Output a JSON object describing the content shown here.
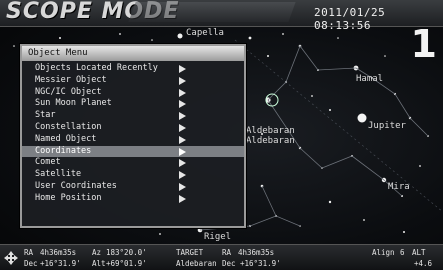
{
  "header": {
    "mode_title": "SCOPE MODE",
    "datetime": "2011/01/25 08:13:56",
    "screen_number": "1"
  },
  "sky_labels": {
    "capella": "Capella",
    "aldebaran_1": "Aldebaran",
    "aldebaran_2": "Aldebaran",
    "jupiter": "Jupiter",
    "mira": "Mira",
    "rigel": "Rigel",
    "hamal": "Hamal"
  },
  "menu": {
    "title": "Object Menu",
    "selected_index": 8,
    "items": [
      "Objects Located Recently",
      "Messier Object",
      "NGC/IC Object",
      "Sun Moon Planet",
      "Star",
      "Constellation",
      "Named Object",
      "Coordinates",
      "Comet",
      "Satellite",
      "User Coordinates",
      "Home Position"
    ]
  },
  "status": {
    "ra_label": "RA",
    "ra_value": "4h36m35s",
    "az_label": "Az",
    "az_value": "183°20.0'",
    "dec_label": "Dec",
    "dec_value": "+16°31.9'",
    "alt_label": "Alt",
    "alt_value": "+69°01.9'",
    "target_label": "TARGET",
    "target_name": "Aldebaran",
    "target_ra_label": "RA",
    "target_ra_value": "4h36m35s",
    "target_dec_label": "Dec",
    "target_dec_value": "+16°31.9'",
    "align_label": "Align",
    "align_value": "6",
    "alt_right_label": "ALT",
    "alt_right_value": "+4.6"
  },
  "icons": {
    "nav": "crosshair-arrow-icon"
  }
}
